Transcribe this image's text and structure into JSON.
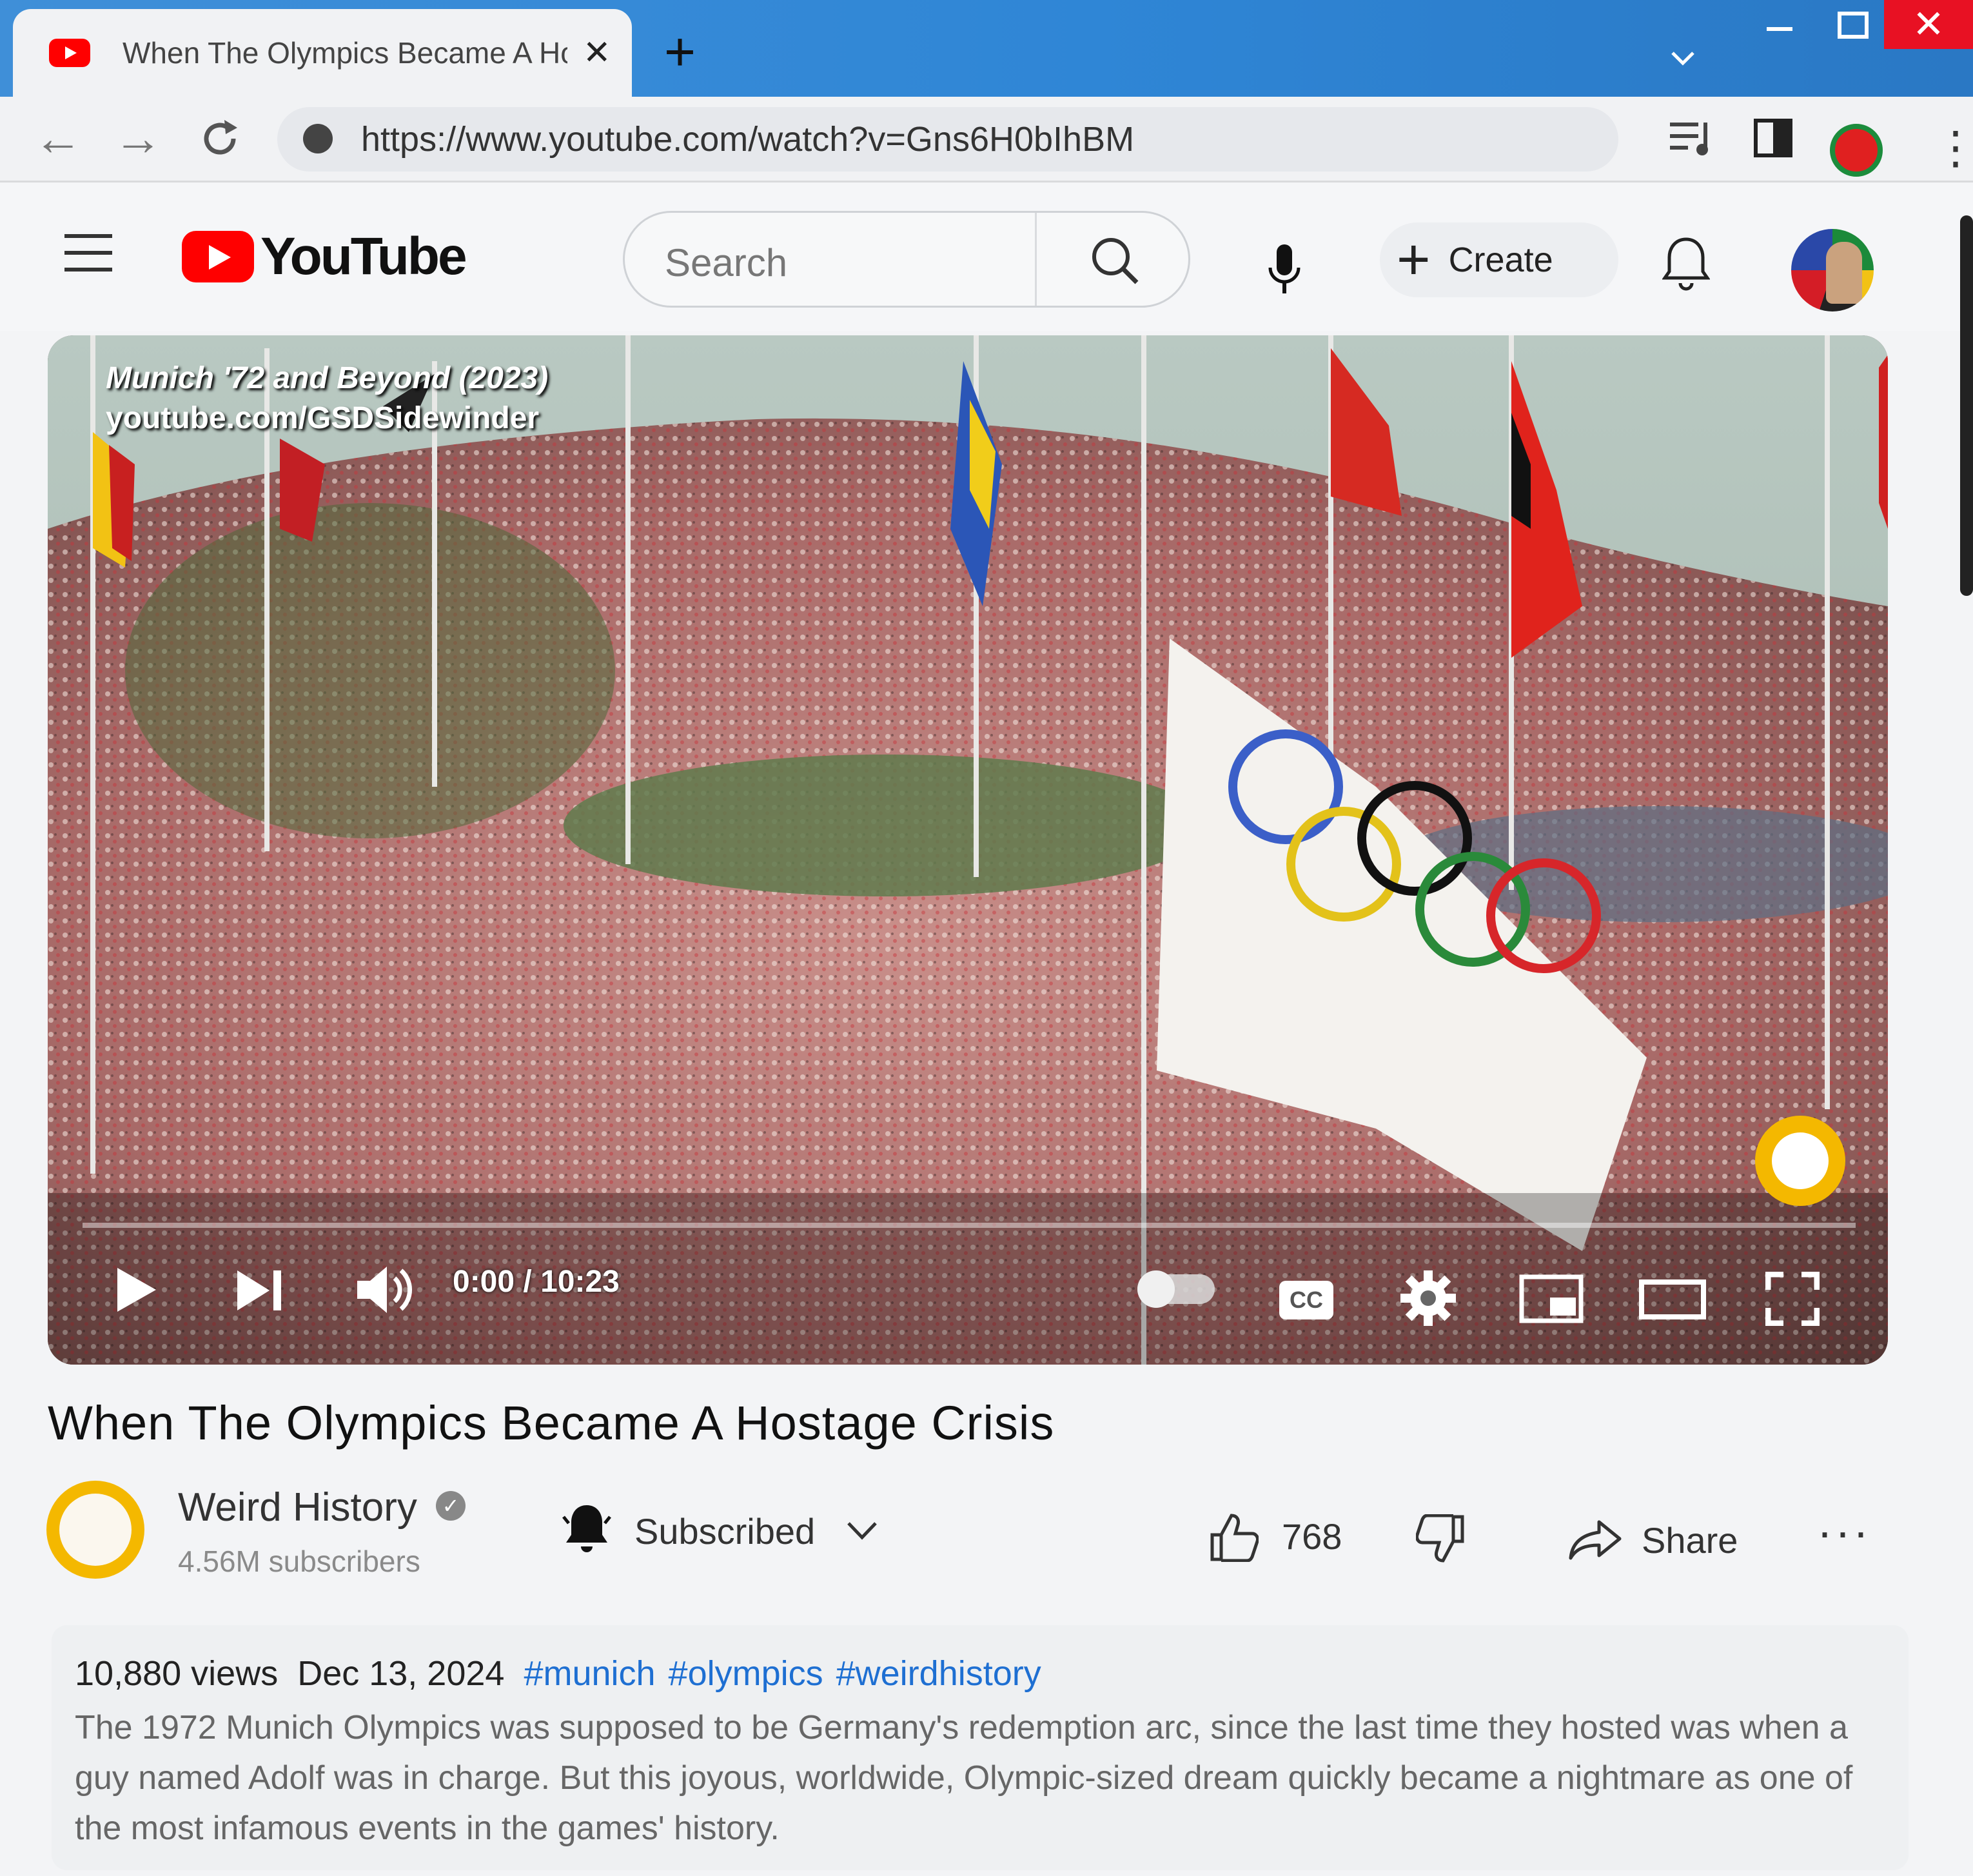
{
  "browser": {
    "tab_title": "When The Olympics Became A Hostage Crisis - YouTube",
    "tab_close": "✕",
    "new_tab": "+",
    "url": "https://www.youtube.com/watch?v=Gns6H0bIhBM",
    "back": "←",
    "forward": "→",
    "reload": "⟳",
    "menu": "⋮",
    "window_close": "✕"
  },
  "masthead": {
    "logo_text": "YouTube",
    "search_placeholder": "Search",
    "create_label": "Create",
    "create_plus": "+"
  },
  "player": {
    "watermark_line1": "Munich '72 and Beyond (2023)",
    "watermark_line2": "youtube.com/GSDSidewinder",
    "time": "0:00 / 10:23",
    "progress_fraction": 0.0,
    "cc_label": "CC"
  },
  "video": {
    "title": "When The Olympics Became A Hostage Crisis",
    "channel_name": "Weird History",
    "verified_mark": "✓",
    "subscribers": "4.56M subscribers",
    "subscribe_label": "Subscribed",
    "likes": "768",
    "share_label": "Share",
    "more_label": "···"
  },
  "description": {
    "views": "10,880 views",
    "date": "Dec 13, 2024",
    "hashtags": [
      "#munich",
      "#olympics",
      "#weirdhistory"
    ],
    "text": "The 1972 Munich Olympics was supposed to be Germany's redemption arc, since the last time they hosted was when a guy named Adolf was in charge. But this joyous, worldwide, Olympic-sized dream quickly became a nightmare as one of the most infamous events in the games' history."
  },
  "colors": {
    "accent_red": "#ff0000",
    "link_blue": "#1e6fd2",
    "tabbar_blue": "#2f86d6"
  },
  "icons": [
    "youtube-favicon",
    "back-icon",
    "forward-icon",
    "reload-icon",
    "site-info-icon",
    "reading-list-icon",
    "side-panel-icon",
    "profile-icon",
    "menu-icon",
    "hamburger-icon",
    "search-icon",
    "microphone-icon",
    "plus-icon",
    "bell-icon",
    "play-icon",
    "next-icon",
    "volume-icon",
    "settings-icon",
    "miniplayer-icon",
    "theater-icon",
    "fullscreen-icon",
    "like-icon",
    "dislike-icon",
    "share-icon"
  ]
}
